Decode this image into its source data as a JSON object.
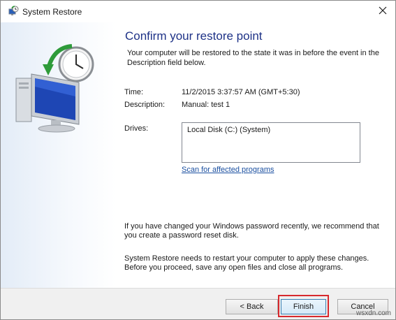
{
  "window": {
    "title": "System Restore"
  },
  "content": {
    "heading": "Confirm your restore point",
    "intro": "Your computer will be restored to the state it was in before the event in the Description field below.",
    "fields": {
      "time_label": "Time:",
      "time_value": "11/2/2015 3:37:57 AM (GMT+5:30)",
      "description_label": "Description:",
      "description_value": "Manual: test 1",
      "drives_label": "Drives:",
      "drives_value": "Local Disk (C:) (System)"
    },
    "scan_link": "Scan for affected programs",
    "note_password": "If you have changed your Windows password recently, we recommend that you create a password reset disk.",
    "note_restart": "System Restore needs to restart your computer to apply these changes. Before you proceed, save any open files and close all programs."
  },
  "footer": {
    "back_label": "< Back",
    "finish_label": "Finish",
    "cancel_label": "Cancel"
  },
  "watermark": "wsxdn.com",
  "icons": {
    "title": "system-restore-icon",
    "close": "close-icon",
    "hero": "system-restore-monitor-clock-icon"
  },
  "colors": {
    "heading": "#1e3287",
    "link": "#1a4fa0",
    "highlight": "#d7292d"
  }
}
